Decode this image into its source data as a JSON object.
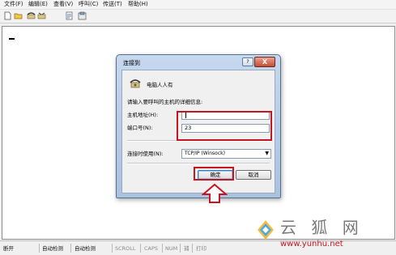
{
  "menubar": {
    "items": [
      "文件(F)",
      "编辑(E)",
      "查看(V)",
      "呼叫(C)",
      "传送(T)",
      "帮助(H)"
    ]
  },
  "toolbar": {
    "icons": [
      "new-file-icon",
      "open-folder-icon",
      "phone-icon",
      "disconnect-icon",
      "send-icon",
      "properties-icon"
    ]
  },
  "dialog": {
    "title": "连接到",
    "help": "?",
    "close": "X",
    "connection_name": "电脑人人有",
    "prompt": "请输入要呼叫的主机的详细信息:",
    "host_label": "主机地址(H):",
    "host_value": "",
    "port_label": "端口号(N):",
    "port_value": "23",
    "connect_using_label": "连接时使用(N):",
    "connect_using_value": "TCP/IP (Winsock)",
    "ok": "确定",
    "cancel": "取消"
  },
  "statusbar": {
    "items": [
      "断开",
      "自动检测",
      "自动检测",
      "SCROLL",
      "CAPS",
      "NUM",
      "捕",
      "打印"
    ]
  },
  "watermark": {
    "text": "云 狐 网",
    "url": "www.yunhu.net"
  },
  "colors": {
    "highlight_red": "#c8141e",
    "dialog_frame": "#a9c2e0"
  }
}
